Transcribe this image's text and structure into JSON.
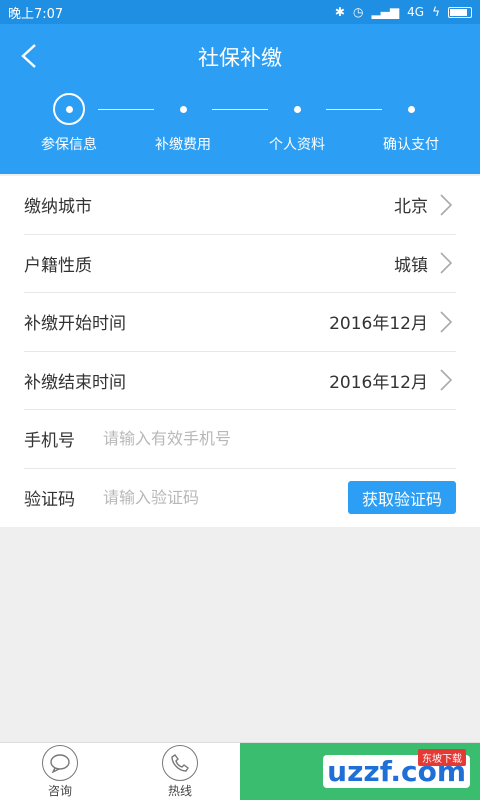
{
  "status_bar": {
    "time": "晚上7:07",
    "network": "4G"
  },
  "header": {
    "title": "社保补缴"
  },
  "steps": [
    {
      "label": "参保信息",
      "active": true
    },
    {
      "label": "补缴费用",
      "active": false
    },
    {
      "label": "个人资料",
      "active": false
    },
    {
      "label": "确认支付",
      "active": false
    }
  ],
  "form": {
    "city": {
      "label": "缴纳城市",
      "value": "北京"
    },
    "household": {
      "label": "户籍性质",
      "value": "城镇"
    },
    "start_time": {
      "label": "补缴开始时间",
      "value": "2016年12月"
    },
    "end_time": {
      "label": "补缴结束时间",
      "value": "2016年12月"
    },
    "phone": {
      "label": "手机号",
      "placeholder": "请输入有效手机号"
    },
    "code": {
      "label": "验证码",
      "placeholder": "请输入验证码",
      "button": "获取验证码"
    }
  },
  "bottom": {
    "consult": "咨询",
    "hotline": "热线",
    "watermark": "uzzf.com",
    "watermark_tag": "东坡下载"
  },
  "colors": {
    "primary": "#2c9ff5",
    "green": "#3bbd6f"
  }
}
